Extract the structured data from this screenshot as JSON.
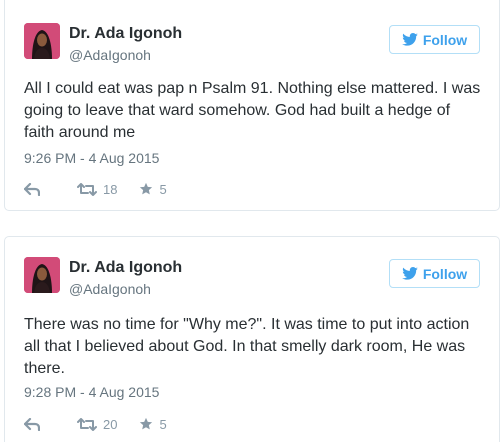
{
  "tweets": [
    {
      "name": "Dr. Ada Igonoh",
      "handle": "@AdaIgonoh",
      "follow_label": "Follow",
      "text": "All I could eat was pap n Psalm 91. Nothing else mattered. I was going to leave that ward somehow. God had built a hedge of faith around me",
      "timestamp": "9:26 PM - 4 Aug 2015",
      "retweets": "18",
      "favorites": "5"
    },
    {
      "name": "Dr. Ada Igonoh",
      "handle": "@AdaIgonoh",
      "follow_label": "Follow",
      "text": "There was no time for \"Why me?\". It was time to put into action all that I believed about God. In that smelly dark room, He was there.",
      "timestamp": "9:28 PM - 4 Aug 2015",
      "retweets": "20",
      "favorites": "5"
    }
  ],
  "colors": {
    "accent": "#3ea1ec",
    "text": "#292f33",
    "muted": "#66757f",
    "icon": "#8899a6",
    "border": "#e1e8ed"
  },
  "icons": [
    "twitter-bird-icon",
    "reply-icon",
    "retweet-icon",
    "favorite-star-icon"
  ]
}
